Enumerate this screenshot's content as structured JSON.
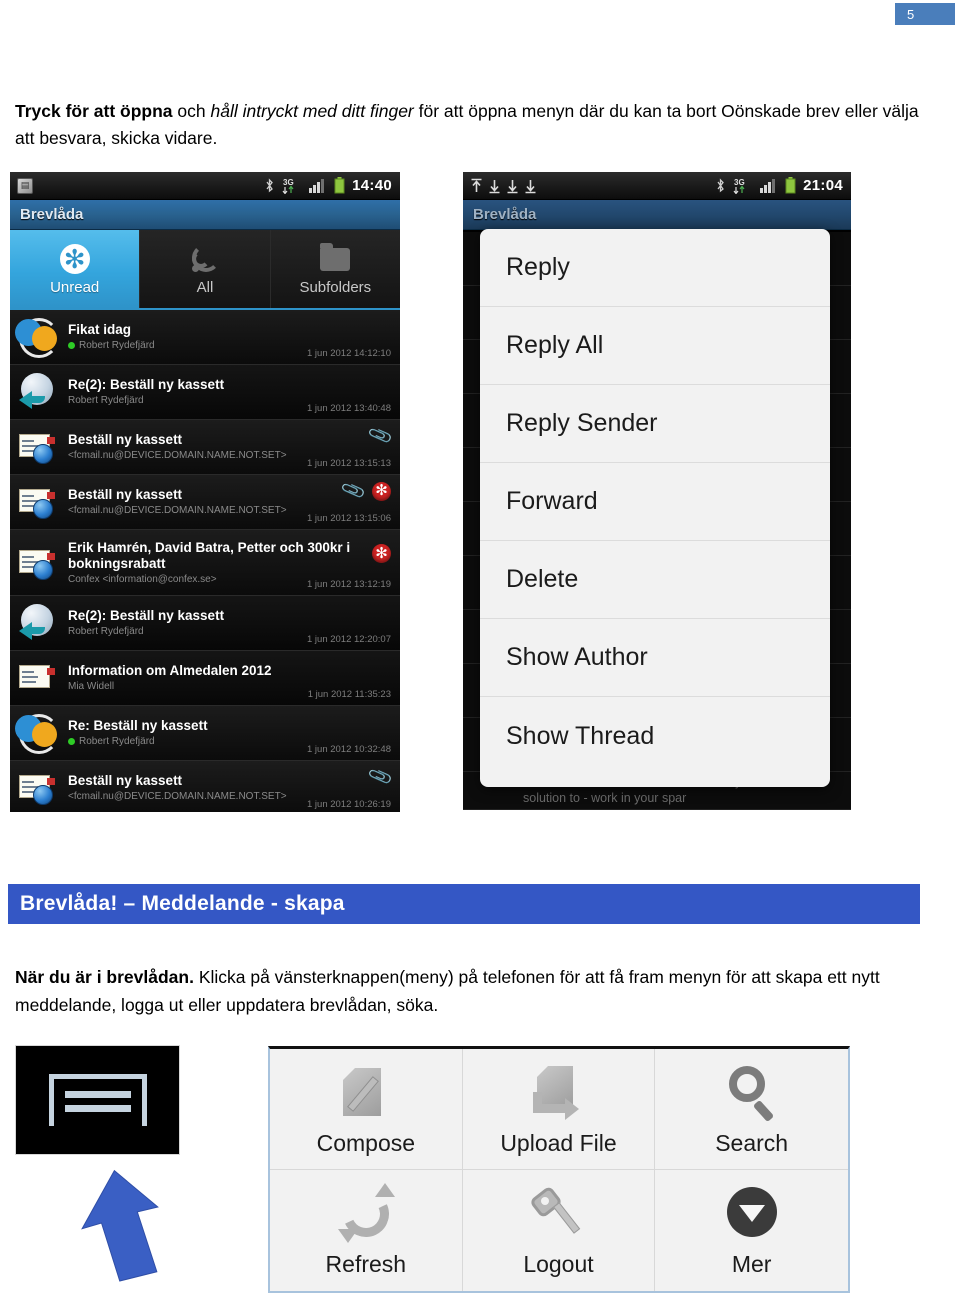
{
  "page": {
    "number": "5"
  },
  "intro": {
    "bold": "Tryck för att öppna",
    "mid1": " och ",
    "italic": "håll intryckt med ditt finger",
    "rest": " för att öppna menyn där du kan ta bort Oönskade brev eller välja att besvara, skicka vidare."
  },
  "phone_left": {
    "status": {
      "time": "14:40",
      "icons": [
        "app-icon",
        "bluetooth-icon",
        "3g-icon",
        "signal-icon",
        "battery-icon"
      ]
    },
    "title": "Brevlåda",
    "tabs": [
      {
        "label": "Unread",
        "icon": "asterisk-icon",
        "active": true
      },
      {
        "label": "All",
        "icon": "rss-icon",
        "active": false
      },
      {
        "label": "Subfolders",
        "icon": "folder-icon",
        "active": false
      }
    ],
    "messages": [
      {
        "subject": "Fikat idag",
        "sender": "Robert Rydefjärd",
        "time": "1 jun 2012 14:12:10",
        "icon": "gears-icon",
        "online": true,
        "attachment": false,
        "flag": false
      },
      {
        "subject": "Re(2): Beställ ny kassett",
        "sender": "Robert Rydefjärd",
        "time": "1 jun 2012 13:40:48",
        "icon": "reply-icon",
        "online": false,
        "attachment": false,
        "flag": false
      },
      {
        "subject": "Beställ ny kassett",
        "sender": "<fcmail.nu@DEVICE.DOMAIN.NAME.NOT.SET>",
        "time": "1 jun 2012 13:15:13",
        "icon": "letter-icon",
        "online": false,
        "attachment": true,
        "flag": false
      },
      {
        "subject": "Beställ ny kassett",
        "sender": "<fcmail.nu@DEVICE.DOMAIN.NAME.NOT.SET>",
        "time": "1 jun 2012 13:15:06",
        "icon": "letter-icon",
        "online": false,
        "attachment": true,
        "flag": true
      },
      {
        "subject": "Erik Hamrén, David Batra, Petter och 300kr i bokningsrabatt",
        "sender": "Confex <information@confex.se>",
        "time": "1 jun 2012 13:12:19",
        "icon": "letter-icon",
        "online": false,
        "attachment": false,
        "flag": true
      },
      {
        "subject": "Re(2): Beställ ny kassett",
        "sender": "Robert Rydefjärd",
        "time": "1 jun 2012 12:20:07",
        "icon": "reply-icon",
        "online": false,
        "attachment": false,
        "flag": false
      },
      {
        "subject": "Information om Almedalen 2012",
        "sender": "Mia Widell",
        "time": "1 jun 2012 11:35:23",
        "icon": "letter-plain-icon",
        "online": false,
        "attachment": false,
        "flag": false
      },
      {
        "subject": "Re: Beställ ny kassett",
        "sender": "Robert Rydefjärd",
        "time": "1 jun 2012 10:32:48",
        "icon": "gears-icon",
        "online": true,
        "attachment": false,
        "flag": false
      },
      {
        "subject": "Beställ ny kassett",
        "sender": "<fcmail.nu@DEVICE.DOMAIN.NAME.NOT.SET>",
        "time": "1 jun 2012 10:26:19",
        "icon": "letter-icon",
        "online": false,
        "attachment": true,
        "flag": false
      }
    ]
  },
  "phone_right": {
    "status": {
      "time": "21:04",
      "icons": [
        "upload-icon",
        "download-icon",
        "download-icon",
        "download-icon",
        "bluetooth-icon",
        "3g-icon",
        "signal-icon",
        "battery-icon"
      ]
    },
    "title": "Brevlåda",
    "context_menu": [
      "Reply",
      "Reply All",
      "Reply Sender",
      "Forward",
      "Delete",
      "Show Author",
      "Show Thread"
    ],
    "background_message": "Re: Fwd: You do not have much money? We offer a solution to - work in your spar"
  },
  "section": {
    "heading": "Brevlåda! – Meddelande - skapa"
  },
  "body": {
    "bold": "När du är i brevlådan.",
    "rest": " Klicka på vänsterknappen(meny) på telefonen för att få fram menyn för att skapa ett nytt meddelande, logga ut eller uppdatera brevlådan, söka."
  },
  "options_panel": {
    "items": [
      {
        "label": "Compose",
        "icon": "compose-icon"
      },
      {
        "label": "Upload File",
        "icon": "upload-file-icon"
      },
      {
        "label": "Search",
        "icon": "search-icon"
      },
      {
        "label": "Refresh",
        "icon": "refresh-icon"
      },
      {
        "label": "Logout",
        "icon": "key-icon"
      },
      {
        "label": "Mer",
        "icon": "more-icon"
      }
    ]
  },
  "colors": {
    "accent_blue": "#3457c5",
    "badge_blue": "#4a7ebb",
    "tab_active": "#34a5dd",
    "arrow_blue": "#3a5fc4"
  }
}
